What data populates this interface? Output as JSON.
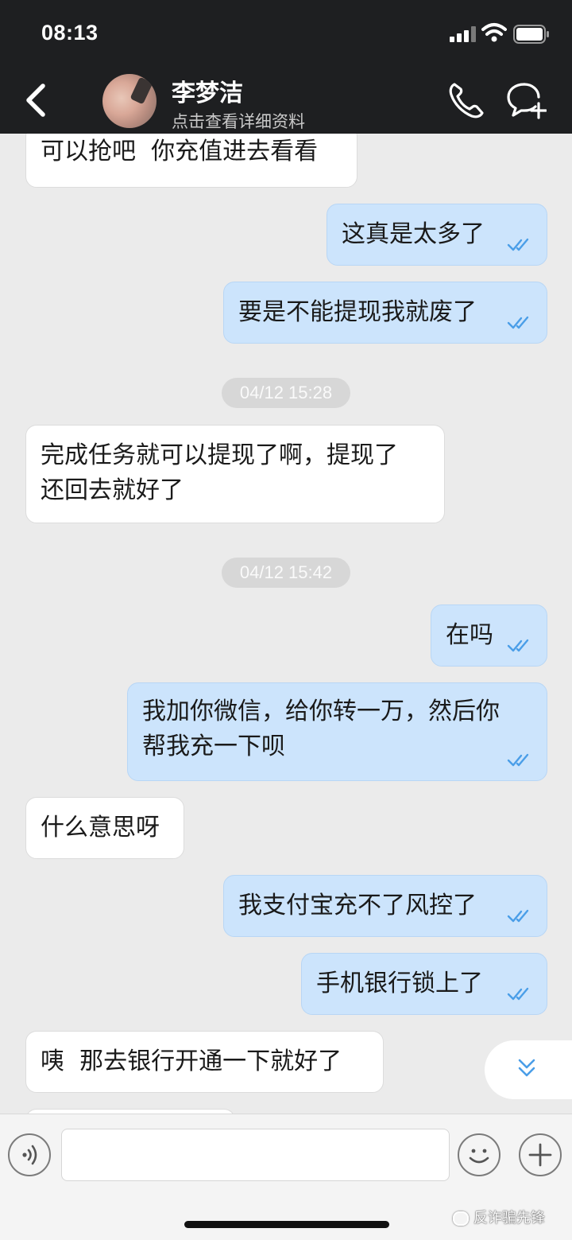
{
  "status_bar": {
    "time": "08:13"
  },
  "header": {
    "contact_name": "李梦洁",
    "subtitle": "点击查看详细资料"
  },
  "messages": [
    {
      "side": "in",
      "text": "可以抢吧  你充值进去看看"
    },
    {
      "side": "out",
      "text": "这真是太多了",
      "read": true
    },
    {
      "side": "out",
      "text": "要是不能提现我就废了",
      "read": true
    },
    {
      "type": "timestamp",
      "text": "04/12 15:28"
    },
    {
      "side": "in",
      "text": "完成任务就可以提现了啊，提现了\n还回去就好了"
    },
    {
      "type": "timestamp",
      "text": "04/12 15:42"
    },
    {
      "side": "out",
      "text": "在吗",
      "read": true
    },
    {
      "side": "out",
      "text": "我加你微信，给你转一万，然后你\n帮我充一下呗",
      "read": true
    },
    {
      "side": "in",
      "text": "什么意思呀"
    },
    {
      "side": "out",
      "text": "我支付宝充不了风控了",
      "read": true
    },
    {
      "side": "out",
      "text": "手机银行锁上了",
      "read": true
    },
    {
      "side": "in",
      "text": "咦  那去银行开通一下就好了"
    }
  ],
  "watermark": {
    "text": "反诈骗先锋"
  },
  "colors": {
    "header_bg": "#1e1f21",
    "chat_bg": "#ebebeb",
    "outgoing_bubble": "#cce4fc",
    "incoming_bubble": "#ffffff",
    "read_tick": "#4a9ee8"
  },
  "icons": [
    "back-arrow-icon",
    "phone-icon",
    "chat-add-icon",
    "double-check-icon",
    "chevron-double-down-icon",
    "voice-icon",
    "emoji-icon",
    "plus-icon",
    "signal-icon",
    "wifi-icon",
    "battery-icon"
  ]
}
